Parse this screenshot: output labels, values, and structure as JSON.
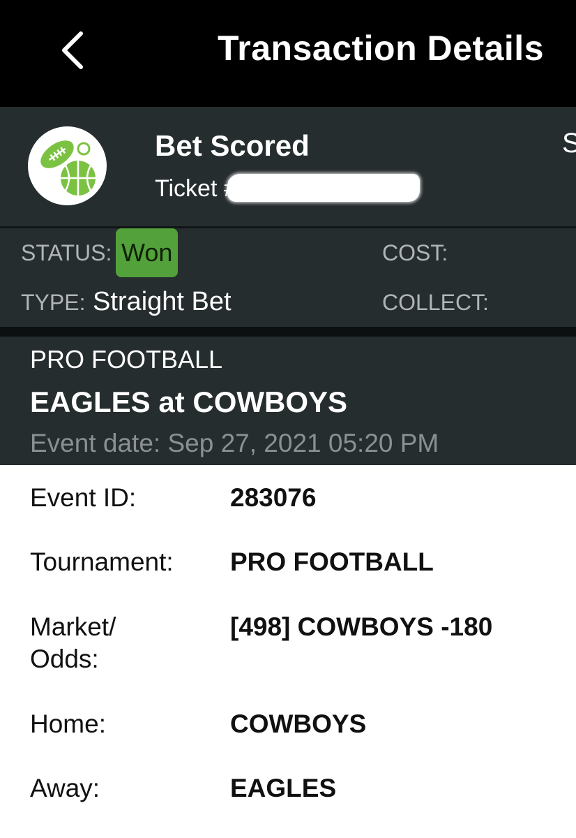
{
  "header": {
    "title": "Transaction Details",
    "back_icon": "chevron-left-icon"
  },
  "bet": {
    "title": "Bet Scored",
    "ticket_label": "Ticket #",
    "logo_icon": "football-basketball-icon",
    "cut_off_text": "S"
  },
  "status_panel": {
    "status_label": "STATUS:",
    "status_value": "Won",
    "type_label": "TYPE:",
    "type_value": "Straight Bet",
    "cost_label": "COST:",
    "collect_label": "COLLECT:"
  },
  "event": {
    "sport": "PRO FOOTBALL",
    "matchup": "EAGLES at COWBOYS",
    "date": "Event date: Sep 27, 2021 05:20 PM"
  },
  "details": [
    {
      "label": "Event ID:",
      "value": "283076"
    },
    {
      "label": "Tournament:",
      "value": "PRO FOOTBALL"
    },
    {
      "label": "Market/\nOdds:",
      "value": "[498] COWBOYS -180"
    },
    {
      "label": "Home:",
      "value": "COWBOYS"
    },
    {
      "label": "Away:",
      "value": "EAGLES"
    }
  ],
  "colors": {
    "won_badge": "#52a13a",
    "panel_bg": "#262d2f",
    "logo_green": "#7cc242"
  }
}
